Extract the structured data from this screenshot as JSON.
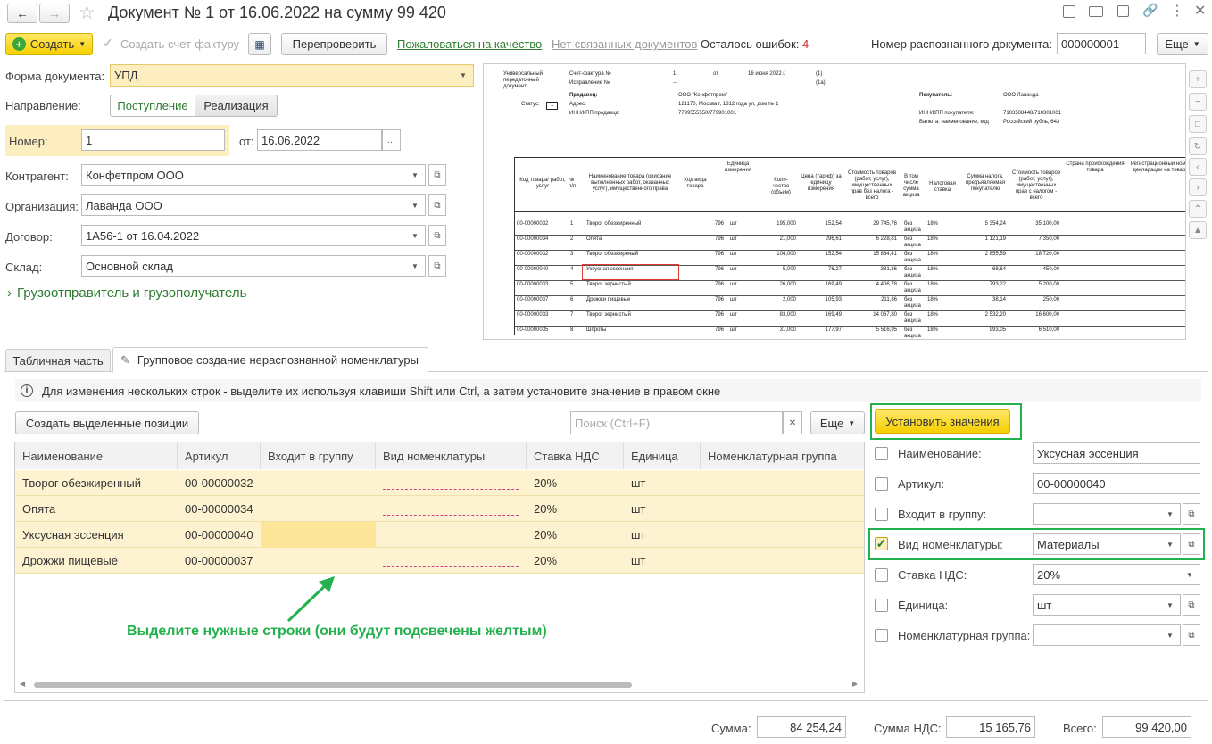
{
  "title": "Документ № 1 от 16.06.2022 на сумму 99 420",
  "toolbar": {
    "create": "Создать",
    "invoice": "Создать счет-фактуру",
    "recheck": "Перепроверить",
    "complain": "Пожаловаться на качество",
    "no_docs": "Нет связанных документов",
    "errors_label": "Осталось ошибок:",
    "errors_count": "4",
    "recognized_label": "Номер распознанного документа:",
    "recognized_value": "000000001",
    "more": "Еще"
  },
  "form": {
    "doc_form_label": "Форма документа:",
    "doc_form_value": "УПД",
    "direction_label": "Направление:",
    "dir_in": "Поступление",
    "dir_out": "Реализация",
    "number_label": "Номер:",
    "number_value": "1",
    "from_label": "от:",
    "date_value": "16.06.2022",
    "counterparty_label": "Контрагент:",
    "counterparty_value": "Конфетпром ООО",
    "org_label": "Организация:",
    "org_value": "Лаванда ООО",
    "contract_label": "Договор:",
    "contract_value": "1А56-1 от 16.04.2022",
    "warehouse_label": "Склад:",
    "warehouse_value": "Основной склад",
    "shipper": "Грузоотправитель и грузополучатель"
  },
  "scan": {
    "r1": "Универсальный передаточный документ",
    "r2": "Счет-фактура №",
    "r3": "1",
    "r4": "от",
    "r5": "16 июня 2022 г.",
    "r6": "(1)",
    "r7": "Исправление №",
    "r8": "--",
    "r9": "(1а)",
    "seller": "Продавец:",
    "seller_v": "ООО \"Конфетпром\"",
    "addr": "Адрес:",
    "addr_v": "121170, Москва г, 1812 года ул, дом № 1",
    "inn": "ИНН/КПП продавца:",
    "inn_v": "7799555550/779901001",
    "buyer": "Покупатель:",
    "buyer_v": "ООО Лаванда",
    "binn": "ИНН/КПП покупателя:",
    "binn_v": "7103508448/710301001",
    "cur": "Валюта: наименование, код",
    "cur_v": "Российский рубль, 643",
    "status": "Статус:",
    "status_v": "1",
    "h_code": "Код товара/ работ, услуг",
    "h_num": "№ п/п",
    "h_name": "Наименование товара (описание выполненных работ, оказанных услуг), имущественного права",
    "h_kind": "Код вида товара",
    "h_unit": "Единица измерения",
    "h_qty": "Коли-чество (объем)",
    "h_price": "Цена (тариф) за единицу измерения",
    "h_cost": "Стоимость товаров (работ, услуг), имущественных прав без налога - всего",
    "h_excise": "В том числе сумма акциза",
    "h_rate": "Налоговая ставка",
    "h_tax": "Сумма налога, предъявляемая покупателю",
    "h_total": "Стоимость товаров (работ, услуг), имущественных прав с налогом - всего",
    "h_country": "Страна происхождения товара",
    "h_decl": "Регистрационный номер декларации на товары",
    "rows": [
      [
        "00-00000032",
        "1",
        "Творог обезжиренный",
        "796",
        "шт",
        "195,000",
        "152,54",
        "29 745,76",
        "без акциза",
        "18%",
        "5 354,24",
        "35 100,00"
      ],
      [
        "00-00000034",
        "2",
        "Опята",
        "796",
        "шт",
        "21,000",
        "296,61",
        "6 228,81",
        "без акциза",
        "18%",
        "1 121,19",
        "7 350,00"
      ],
      [
        "00-00000032",
        "3",
        "Творог обезжиреный",
        "796",
        "шт",
        "104,000",
        "152,54",
        "15 864,41",
        "без акциза",
        "18%",
        "2 855,59",
        "18 720,00"
      ],
      [
        "00-00000040",
        "4",
        "Уксусная эссенция",
        "796",
        "шт",
        "5,000",
        "76,27",
        "381,36",
        "без акциза",
        "18%",
        "68,64",
        "450,00"
      ],
      [
        "00-00000033",
        "5",
        "Творог зернистый",
        "796",
        "шт",
        "26,000",
        "169,49",
        "4 406,78",
        "без акциза",
        "18%",
        "793,22",
        "5 200,00"
      ],
      [
        "00-00000037",
        "6",
        "Дрожжи пищевые",
        "796",
        "шт",
        "2,000",
        "105,93",
        "211,86",
        "без акциза",
        "18%",
        "38,14",
        "250,00"
      ],
      [
        "00-00000033",
        "7",
        "Творог зернистый",
        "796",
        "шт",
        "83,000",
        "169,49",
        "14 067,80",
        "без акциза",
        "18%",
        "2 532,20",
        "16 600,00"
      ],
      [
        "00-00000035",
        "8",
        "Шпроты",
        "796",
        "шт",
        "31,000",
        "177,97",
        "5 516,95",
        "без акциза",
        "18%",
        "993,05",
        "6 510,00"
      ]
    ]
  },
  "tabs": {
    "t1": "Табличная часть",
    "t2": "Групповое создание нераспознанной номенклатуры"
  },
  "info": "Для изменения нескольких строк - выделите их используя клавиши Shift или Ctrl, а затем установите значение в правом окне",
  "grid": {
    "create_selected": "Создать выделенные позиции",
    "search_placeholder": "Поиск (Ctrl+F)",
    "more": "Еще",
    "cols": [
      "Наименование",
      "Артикул",
      "Входит в группу",
      "Вид номенклатуры",
      "Ставка НДС",
      "Единица",
      "Номенклатурная группа"
    ],
    "rows": [
      {
        "name": "Творог обезжиренный",
        "art": "00-00000032",
        "vat": "20%",
        "unit": "шт"
      },
      {
        "name": "Опята",
        "art": "00-00000034",
        "vat": "20%",
        "unit": "шт"
      },
      {
        "name": "Уксусная эссенция",
        "art": "00-00000040",
        "vat": "20%",
        "unit": "шт"
      },
      {
        "name": "Дрожжи пищевые",
        "art": "00-00000037",
        "vat": "20%",
        "unit": "шт"
      }
    ]
  },
  "annotation": "Выделите нужные строки (они будут подсвечены желтым)",
  "panel": {
    "set_values": "Установить значения",
    "name_label": "Наименование:",
    "name_value": "Уксусная эссенция",
    "art_label": "Артикул:",
    "art_value": "00-00000040",
    "group_label": "Входит в группу:",
    "group_value": "",
    "kind_label": "Вид номенклатуры:",
    "kind_value": "Материалы",
    "vat_label": "Ставка НДС:",
    "vat_value": "20%",
    "unit_label": "Единица:",
    "unit_value": "шт",
    "ngroup_label": "Номенклатурная группа:",
    "ngroup_value": ""
  },
  "totals": {
    "sum_label": "Сумма:",
    "sum_value": "84 254,24",
    "vat_label": "Сумма НДС:",
    "vat_value": "15 165,76",
    "total_label": "Всего:",
    "total_value": "99 420,00"
  }
}
